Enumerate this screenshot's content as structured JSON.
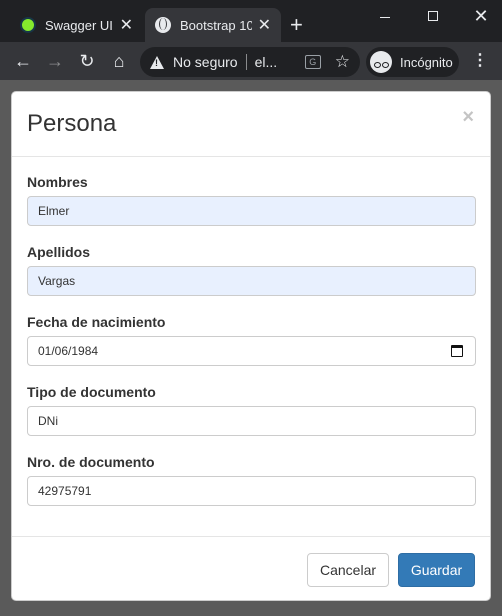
{
  "browser": {
    "tabs": [
      {
        "title": "Swagger UI",
        "icon": "swagger-icon",
        "close": "✕"
      },
      {
        "title": "Bootstrap 10",
        "icon": "globe-icon",
        "close": "✕"
      }
    ],
    "new_tab": "+",
    "window_controls": {
      "close": "✕"
    },
    "omnibox": {
      "security_text": "No seguro",
      "url": "el..."
    },
    "translate_glyph": "G",
    "incognito_label": "Incógnito"
  },
  "modal": {
    "title": "Persona",
    "close": "×",
    "fields": [
      {
        "label": "Nombres",
        "value": "Elmer"
      },
      {
        "label": "Apellidos",
        "value": "Vargas"
      },
      {
        "label": "Fecha de nacimiento",
        "value": "01/06/1984"
      },
      {
        "label": "Tipo de documento",
        "value": "DNi"
      },
      {
        "label": "Nro. de documento",
        "value": "42975791"
      }
    ],
    "buttons": {
      "cancel": "Cancelar",
      "save": "Guardar"
    }
  },
  "colors": {
    "primary": "#337ab7",
    "autofill": "#e8f0fe",
    "chrome_dark": "#202124"
  }
}
